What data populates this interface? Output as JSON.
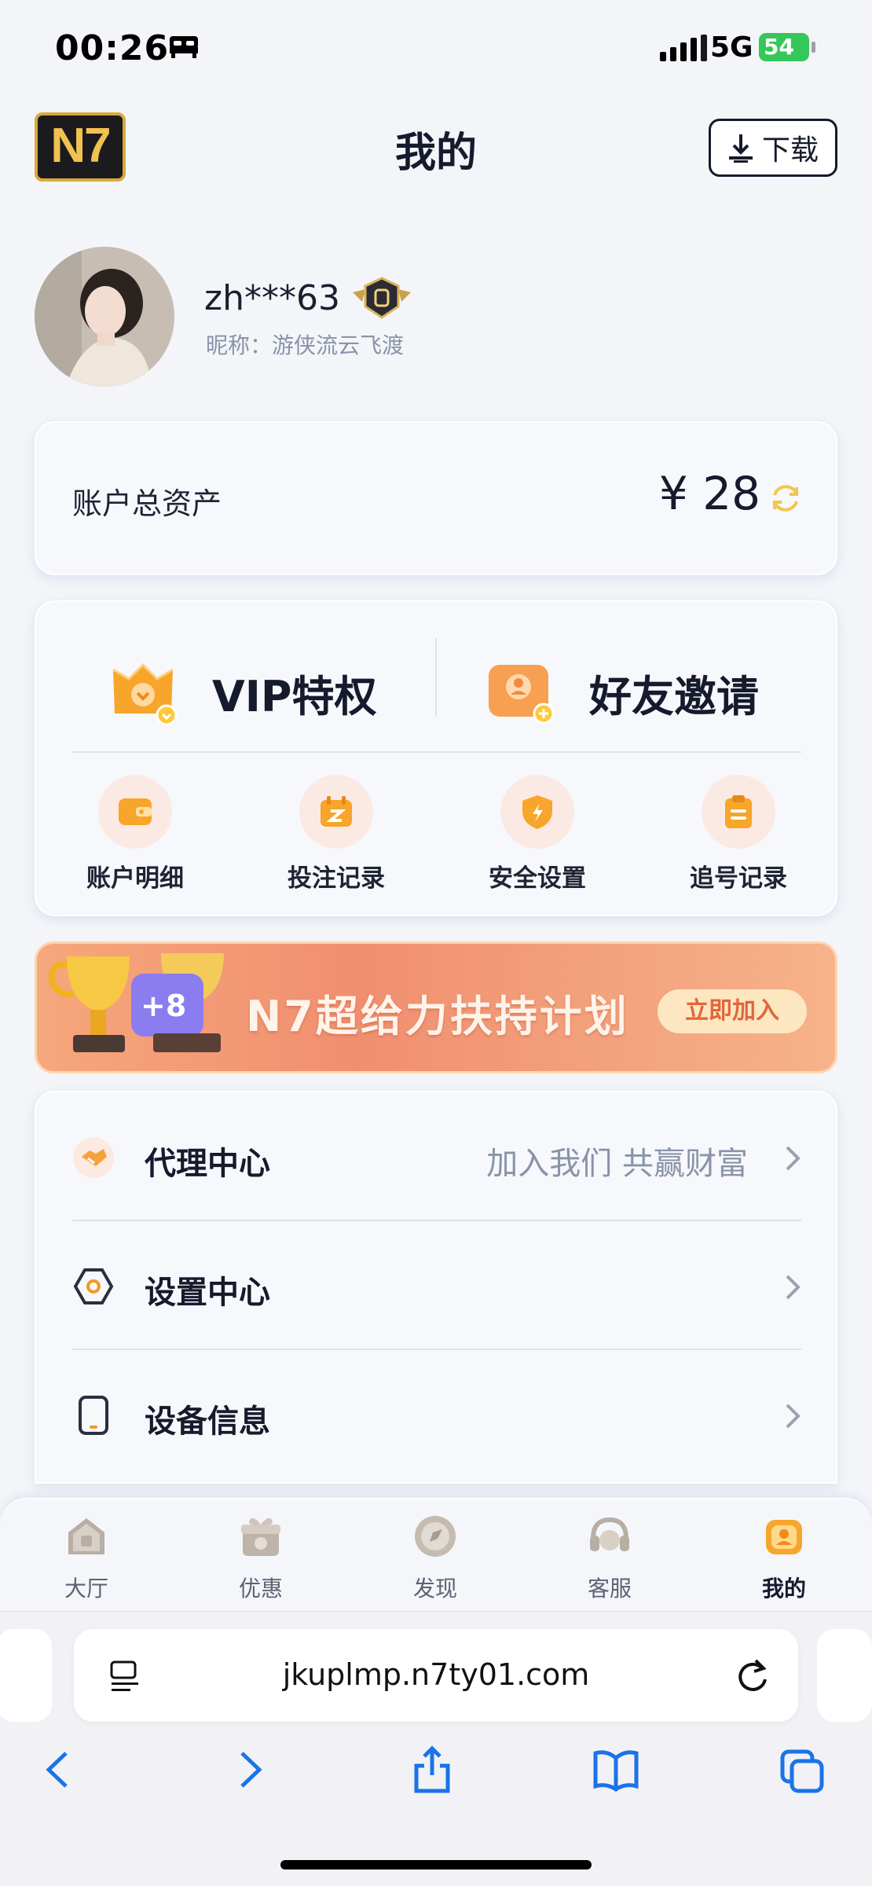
{
  "status_bar": {
    "time": "00:26",
    "network": "5G",
    "battery": "54"
  },
  "header": {
    "logo": "N7",
    "title": "我的",
    "download_label": "下载"
  },
  "profile": {
    "username": "zh***63",
    "nickname": "昵称：游侠流云飞渡"
  },
  "assets": {
    "label": "账户总资产",
    "value": "¥ 28"
  },
  "features": {
    "vip_label": "VIP特权",
    "invite_label": "好友邀请",
    "items": [
      {
        "label": "账户明细"
      },
      {
        "label": "投注记录"
      },
      {
        "label": "安全设置"
      },
      {
        "label": "追号记录"
      }
    ]
  },
  "banner": {
    "text": "N7超给力扶持计划",
    "button": "立即加入"
  },
  "menu": [
    {
      "label": "代理中心",
      "hint": "加入我们 共赢财富"
    },
    {
      "label": "设置中心",
      "hint": ""
    },
    {
      "label": "设备信息",
      "hint": ""
    }
  ],
  "tabs": [
    {
      "label": "大厅"
    },
    {
      "label": "优惠"
    },
    {
      "label": "发现"
    },
    {
      "label": "客服"
    },
    {
      "label": "我的"
    }
  ],
  "browser": {
    "url": "jkuplmp.n7ty01.com"
  },
  "colors": {
    "accent": "#f7a52b",
    "primary_text": "#151a2c",
    "muted_text": "#8a93a8",
    "banner": "#f08f70"
  }
}
